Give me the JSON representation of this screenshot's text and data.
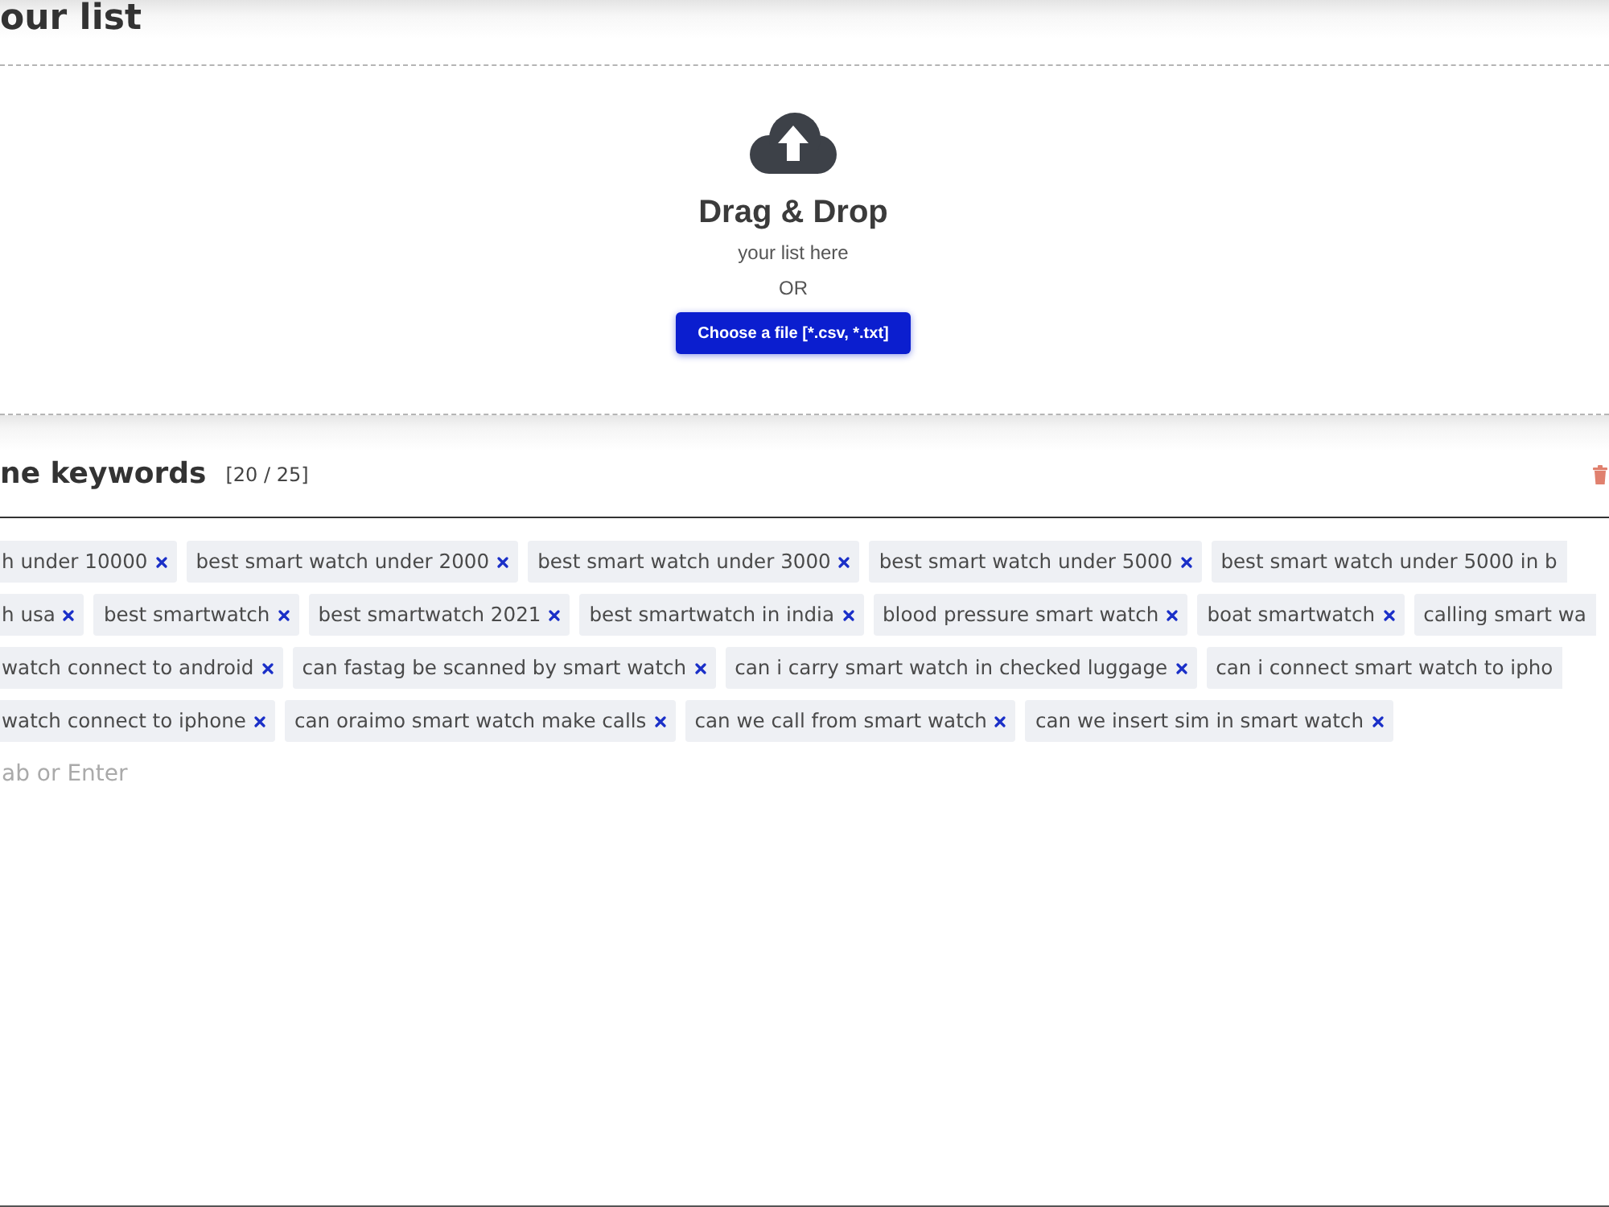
{
  "header": {
    "title": "our list"
  },
  "dropzone": {
    "title": "Drag & Drop",
    "subtitle": "your list here",
    "separator": "OR",
    "button": "Choose a file [*.csv, *.txt]"
  },
  "keywords": {
    "title": "ne keywords",
    "count": "[20 / 25]",
    "rows": [
      {
        "tags": [
          {
            "label": "h under 10000",
            "kind": "clipped-left"
          },
          {
            "label": "best smart watch under 2000",
            "kind": "full"
          },
          {
            "label": "best smart watch under 3000",
            "kind": "full"
          },
          {
            "label": "best smart watch under 5000",
            "kind": "full"
          },
          {
            "label": "best smart watch under 5000 in b",
            "kind": "clipped-right"
          }
        ]
      },
      {
        "tags": [
          {
            "label": "h usa",
            "kind": "clipped-left"
          },
          {
            "label": "best smartwatch",
            "kind": "full"
          },
          {
            "label": "best smartwatch 2021",
            "kind": "full"
          },
          {
            "label": "best smartwatch in india",
            "kind": "full"
          },
          {
            "label": "blood pressure smart watch",
            "kind": "full"
          },
          {
            "label": "boat smartwatch",
            "kind": "full"
          },
          {
            "label": "calling smart wa",
            "kind": "clipped-right"
          }
        ]
      },
      {
        "tags": [
          {
            "label": "watch connect to android",
            "kind": "clipped-left"
          },
          {
            "label": "can fastag be scanned by smart watch",
            "kind": "full"
          },
          {
            "label": "can i carry smart watch in checked luggage",
            "kind": "full"
          },
          {
            "label": "can i connect smart watch to ipho",
            "kind": "clipped-right"
          }
        ]
      },
      {
        "tags": [
          {
            "label": "watch connect to iphone",
            "kind": "clipped-left"
          },
          {
            "label": "can oraimo smart watch make calls",
            "kind": "full"
          },
          {
            "label": "can we call from smart watch",
            "kind": "full"
          },
          {
            "label": "can we insert sim in smart watch",
            "kind": "full"
          }
        ]
      }
    ],
    "input": {
      "placeholder": "ab or Enter"
    }
  }
}
